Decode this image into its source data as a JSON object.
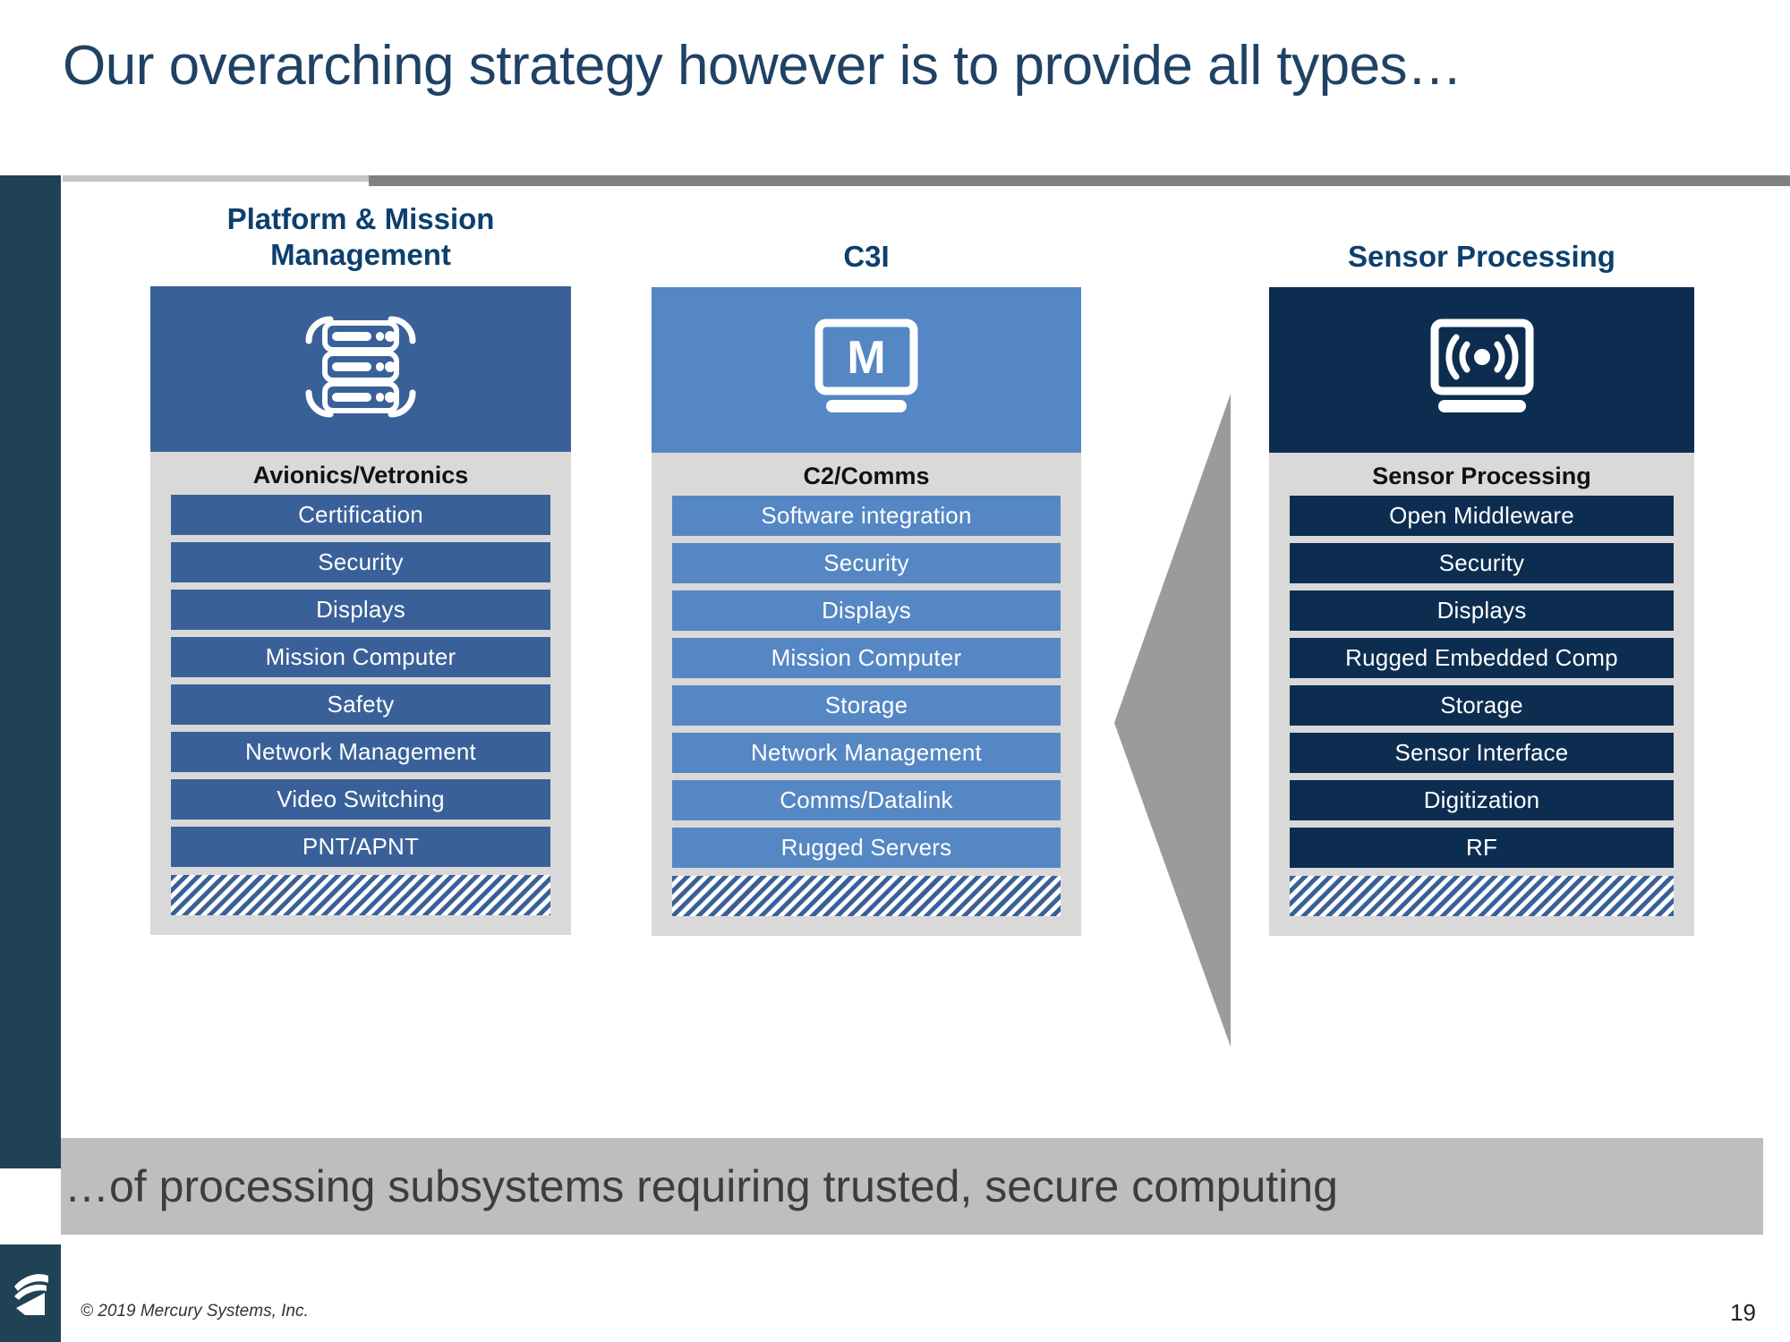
{
  "slide": {
    "title": "Our overarching strategy however is to provide all types…",
    "page_number": "19",
    "copyright": "© 2019 Mercury Systems, Inc.",
    "banner_text": "…of processing subsystems requiring trusted, secure computing"
  },
  "colors": {
    "title_blue": "#1F4264",
    "heading_blue": "#0D3F6E",
    "column1_blue": "#3A6099",
    "column2_blue": "#5487C4",
    "column3_navy": "#0D2D50",
    "panel_gray": "#D9D9D9",
    "banner_gray": "#BEBEBE",
    "arrow_gray": "#9B9B9B",
    "sidebar_teal": "#1F4254"
  },
  "columns": [
    {
      "id": "pmm",
      "title": "Platform & Mission\nManagement",
      "icon": "server-rack-icon",
      "subhead": "Avionics/Vetronics",
      "items": [
        "Certification",
        "Security",
        "Displays",
        "Mission Computer",
        "Safety",
        "Network Management",
        "Video Switching",
        "PNT/APNT"
      ]
    },
    {
      "id": "c3i",
      "title": "C3I",
      "icon": "laptop-m-icon",
      "subhead": "C2/Comms",
      "items": [
        "Software integration",
        "Security",
        "Displays",
        "Mission Computer",
        "Storage",
        "Network Management",
        "Comms/Datalink",
        "Rugged Servers"
      ]
    },
    {
      "id": "sp",
      "title": "Sensor Processing",
      "icon": "laptop-signal-icon",
      "subhead": "Sensor Processing",
      "items": [
        "Open Middleware",
        "Security",
        "Displays",
        "Rugged Embedded Comp",
        "Storage",
        "Sensor Interface",
        "Digitization",
        "RF"
      ]
    }
  ],
  "arrow": {
    "name": "left-pointing-arrow",
    "direction": "left"
  }
}
